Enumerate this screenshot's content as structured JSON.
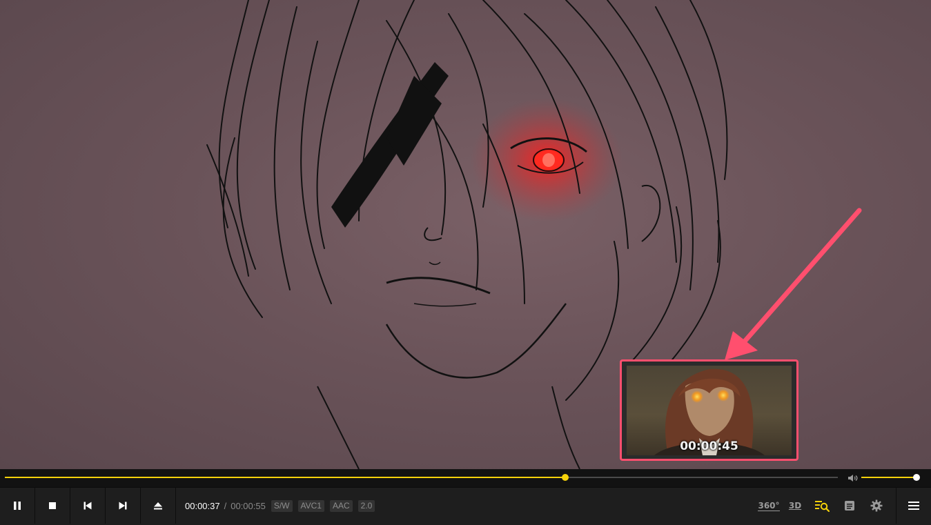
{
  "player": {
    "thumbnail_time": "00:00:45",
    "playback": {
      "current_time": "00:00:37",
      "separator": "/",
      "duration": "00:00:55",
      "progress_fraction": 0.6727
    },
    "volume_fraction": 1.0,
    "badges": [
      "S/W",
      "AVC1",
      "AAC",
      "2.0"
    ],
    "buttons": {
      "pause": "pause-icon",
      "stop": "stop-icon",
      "previous": "previous-icon",
      "next": "next-icon",
      "eject": "eject-icon"
    },
    "right_icons": {
      "vr360": "360°",
      "three_d": "3D",
      "playlist_search": "playlist-search-icon",
      "subtitle": "subtitle-icon",
      "settings": "gear-icon",
      "menu": "hamburger-menu-icon"
    },
    "colors": {
      "accent": "#f5d20a",
      "highlight_frame": "#ff4f6e",
      "bar_bg": "#1e1e1e"
    }
  }
}
